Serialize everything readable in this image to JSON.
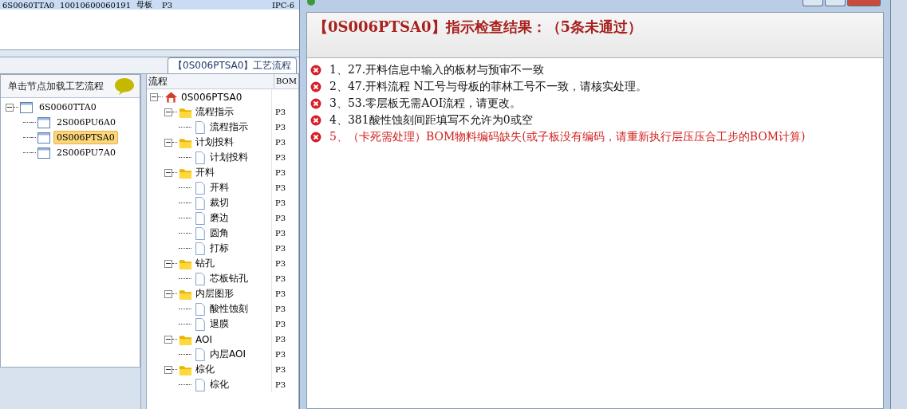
{
  "background_table": {
    "row": [
      "6S0060TTA0",
      "10010600060191",
      "母板",
      "P3",
      "IPC-6"
    ]
  },
  "tab": {
    "label": "【0S006PTSA0】工艺流程",
    "selected": true
  },
  "node_panel": {
    "hint": "单击节点加载工艺流程",
    "tree": [
      {
        "label": "6S0060TTA0",
        "expanded": true,
        "selected": false,
        "children": [
          {
            "label": "2S006PU6A0",
            "selected": false
          },
          {
            "label": "0S006PTSA0",
            "selected": true
          },
          {
            "label": "2S006PU7A0",
            "selected": false
          }
        ]
      }
    ]
  },
  "flow_panel": {
    "columns": [
      "流程",
      "BOM"
    ],
    "tree": [
      {
        "label": "0S006PTSA0",
        "kind": "root",
        "expanded": true,
        "children": [
          {
            "label": "流程指示",
            "kind": "folder",
            "expanded": true,
            "bom": "P3",
            "children": [
              {
                "label": "流程指示",
                "kind": "step",
                "bom": "P3"
              }
            ]
          },
          {
            "label": "计划投料",
            "kind": "folder",
            "expanded": true,
            "bom": "P3",
            "children": [
              {
                "label": "计划投料",
                "kind": "step",
                "bom": "P3"
              }
            ]
          },
          {
            "label": "开料",
            "kind": "folder",
            "expanded": true,
            "bom": "P3",
            "children": [
              {
                "label": "开料",
                "kind": "step",
                "bom": "P3"
              },
              {
                "label": "裁切",
                "kind": "step",
                "bom": "P3"
              },
              {
                "label": "磨边",
                "kind": "step",
                "bom": "P3"
              },
              {
                "label": "圆角",
                "kind": "step",
                "bom": "P3"
              },
              {
                "label": "打标",
                "kind": "step",
                "bom": "P3"
              }
            ]
          },
          {
            "label": "钻孔",
            "kind": "folder",
            "expanded": true,
            "bom": "P3",
            "children": [
              {
                "label": "芯板钻孔",
                "kind": "step",
                "bom": "P3"
              }
            ]
          },
          {
            "label": "内层图形",
            "kind": "folder",
            "expanded": true,
            "bom": "P3",
            "children": [
              {
                "label": "酸性蚀刻",
                "kind": "step",
                "bom": "P3"
              },
              {
                "label": "退膜",
                "kind": "step",
                "bom": "P3"
              }
            ]
          },
          {
            "label": "AOI",
            "kind": "folder",
            "expanded": true,
            "bom": "P3",
            "children": [
              {
                "label": "内层AOI",
                "kind": "step",
                "bom": "P3"
              }
            ]
          },
          {
            "label": "棕化",
            "kind": "folder",
            "expanded": true,
            "bom": "P3",
            "children": [
              {
                "label": "棕化",
                "kind": "step",
                "bom": "P3"
              }
            ]
          }
        ]
      }
    ]
  },
  "dialog": {
    "title": "【0S006PTSA0】指示检查结果：（5条未通过）",
    "items": [
      {
        "text": "1、27.开料信息中输入的板材与预审不一致",
        "blocking": false
      },
      {
        "text": "2、47.开料流程 N工号与母板的菲林工号不一致，请核实处理。",
        "blocking": false
      },
      {
        "text": "3、53.零层板无需AOI流程，请更改。",
        "blocking": false
      },
      {
        "text": "4、381酸性蚀刻间距填写不允许为0或空",
        "blocking": false
      },
      {
        "text": "5、（卡死需处理）BOM物料编码缺失(或子板没有编码，请重新执行层压压合工步的BOM计算)",
        "blocking": true
      }
    ]
  }
}
